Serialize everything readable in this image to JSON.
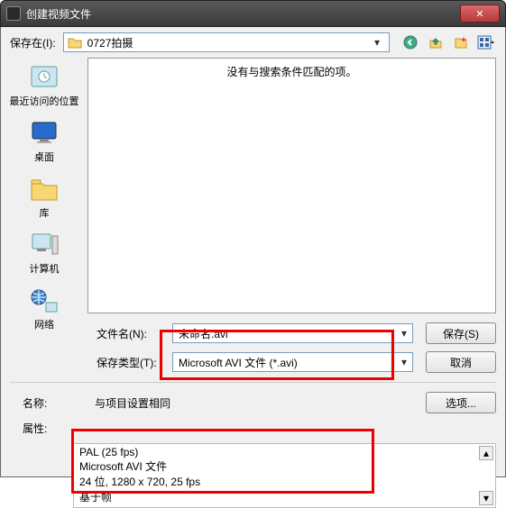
{
  "window": {
    "title": "创建视频文件",
    "close": "✕"
  },
  "toolbar": {
    "saveIn_label": "保存在(I):",
    "location": "0727拍摄"
  },
  "places": [
    {
      "key": "recent",
      "label": "最近访问的位置"
    },
    {
      "key": "desktop",
      "label": "桌面"
    },
    {
      "key": "library",
      "label": "库"
    },
    {
      "key": "computer",
      "label": "计算机"
    },
    {
      "key": "network",
      "label": "网络"
    }
  ],
  "filePane": {
    "empty": "没有与搜索条件匹配的项。"
  },
  "fields": {
    "filename_label": "文件名(N):",
    "filename_value": "未命名.avi",
    "filetype_label": "保存类型(T):",
    "filetype_value": "Microsoft AVI 文件 (*.avi)"
  },
  "buttons": {
    "save": "保存(S)",
    "cancel": "取消",
    "options": "选项..."
  },
  "info": {
    "name_label": "名称:",
    "name_value": "与项目设置相同",
    "attr_label": "属性:",
    "attrs": [
      "PAL (25 fps)",
      "Microsoft AVI 文件",
      "24 位, 1280 x 720, 25 fps",
      "基于帧"
    ]
  }
}
